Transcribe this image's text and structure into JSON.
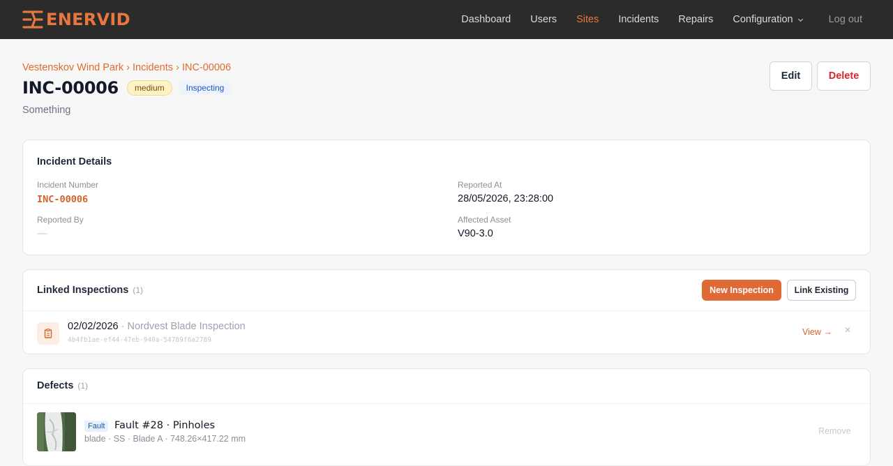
{
  "nav": {
    "brand": "ENERVID",
    "links": [
      "Dashboard",
      "Users",
      "Sites",
      "Incidents",
      "Repairs"
    ],
    "active": "Sites",
    "configuration": "Configuration",
    "logout": "Log out",
    "colors": {
      "bar": "#2b2b2b",
      "accent": "#e8773f"
    }
  },
  "header": {
    "breadcrumb": [
      "Vestenskov Wind Park",
      "Incidents",
      "INC-00006"
    ],
    "breadcrumb_separator": "›",
    "title": "INC-00006",
    "severity": "medium",
    "status": "Inspecting",
    "description": "Something",
    "edit_label": "Edit",
    "delete_label": "Delete"
  },
  "details": {
    "title": "Incident Details",
    "incident_number_label": "Incident Number",
    "incident_number": "INC-00006",
    "reported_at_label": "Reported At",
    "reported_at": "28/05/2026, 23:28:00",
    "reported_by_label": "Reported By",
    "reported_by": "—",
    "affected_asset_label": "Affected Asset",
    "affected_asset": "V90-3.0"
  },
  "inspections": {
    "title": "Linked Inspections",
    "count": "(1)",
    "new_label": "New Inspection",
    "link_label": "Link Existing",
    "items": [
      {
        "date": "02/02/2026",
        "separator": "·",
        "name": "Nordvest Blade Inspection",
        "id": "4b4fb1ae-ef44-47eb-940a-54789f6a2789",
        "view_label": "View →",
        "close": "×"
      }
    ]
  },
  "defects": {
    "title": "Defects",
    "count": "(1)",
    "items": [
      {
        "tag": "Fault",
        "title": "Fault #28 · Pinholes",
        "meta": "blade · SS · Blade A · 748.26×417.22 mm",
        "remove_label": "Remove"
      }
    ]
  }
}
